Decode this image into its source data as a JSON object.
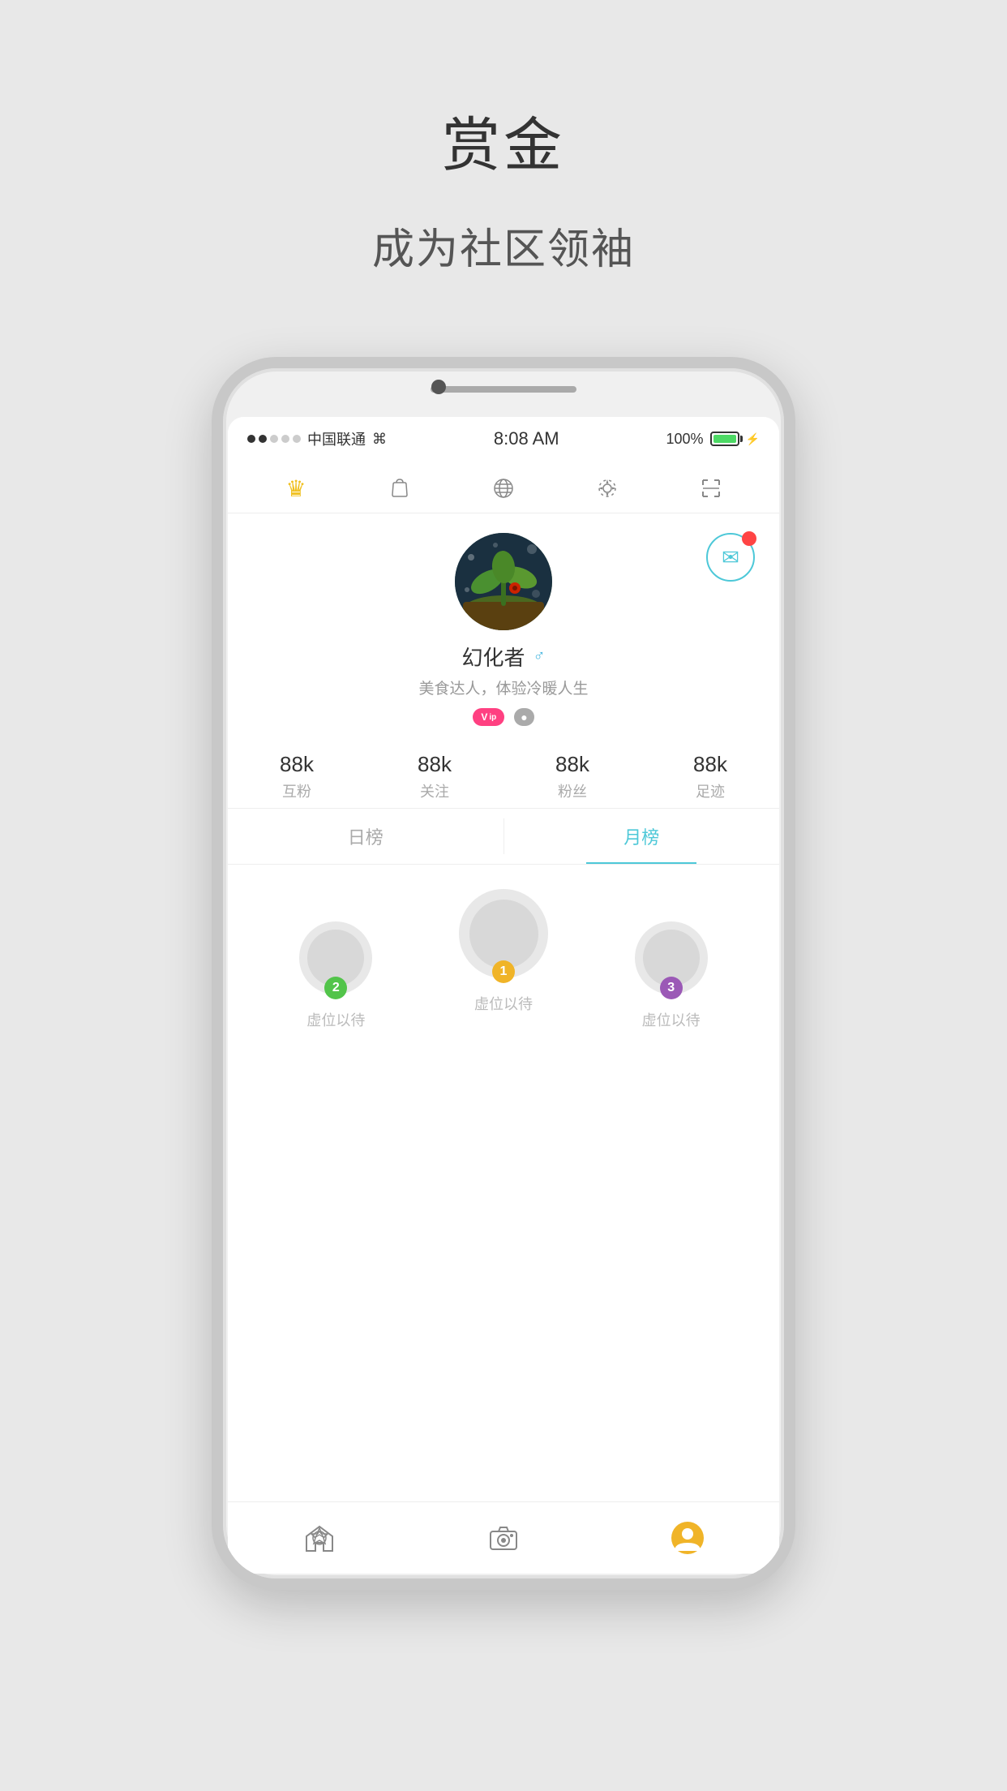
{
  "page": {
    "title": "赏金",
    "subtitle": "成为社区领袖"
  },
  "status_bar": {
    "signal_filled": 2,
    "signal_empty": 3,
    "carrier": "中国联通",
    "time": "8:08 AM",
    "battery_pct": "100%",
    "battery_full": true
  },
  "nav_icons": {
    "crown": "♛",
    "bag": "👜",
    "globe": "🌐",
    "gear": "⚙",
    "scan": "⊡"
  },
  "profile": {
    "username": "幻化者",
    "gender_icon": "♂",
    "bio": "美食达人，体验冷暖人生",
    "badge_vip": "Vip",
    "badge_grey": "●"
  },
  "stats": [
    {
      "value": "88k",
      "label": "互粉"
    },
    {
      "value": "88k",
      "label": "关注"
    },
    {
      "value": "88k",
      "label": "粉丝"
    },
    {
      "value": "88k",
      "label": "足迹"
    }
  ],
  "tabs": [
    {
      "label": "日榜",
      "active": false
    },
    {
      "label": "月榜",
      "active": true
    }
  ],
  "ranking": {
    "positions": [
      {
        "rank": 2,
        "name": "虚位以待",
        "badge_class": "rank-2"
      },
      {
        "rank": 1,
        "name": "虚位以待",
        "badge_class": "rank-1"
      },
      {
        "rank": 3,
        "name": "虚位以待",
        "badge_class": "rank-3"
      }
    ]
  },
  "bottom_nav": [
    {
      "icon": "◈",
      "active": false
    },
    {
      "icon": "⊙",
      "active": false
    },
    {
      "icon": "👤",
      "active": true
    }
  ]
}
